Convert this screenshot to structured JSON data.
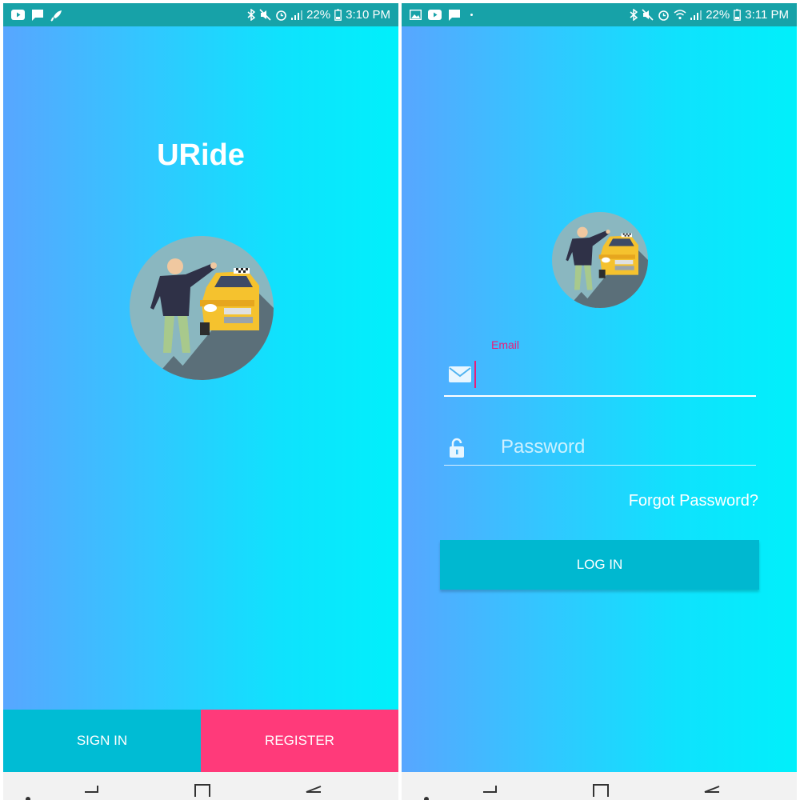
{
  "colors": {
    "statusbar": "#17a2a8",
    "gradient_start": "#58a6ff",
    "gradient_end": "#00f0fb",
    "signin_button": "#00bcd4",
    "register_button": "#ff3a7a",
    "login_button": "#00b8d0",
    "accent": "#e91e7a"
  },
  "left_screen": {
    "status": {
      "icons_left": [
        "youtube-icon",
        "message-icon",
        "rocket-icon"
      ],
      "icons_right": [
        "bluetooth-icon",
        "mute-icon",
        "alarm-icon",
        "signal-icon",
        "battery-icon"
      ],
      "battery": "22%",
      "time": "3:10 PM"
    },
    "title": "URide",
    "logo": "taxi-passenger-logo",
    "signin_label": "SIGN IN",
    "register_label": "REGISTER"
  },
  "right_screen": {
    "status": {
      "icons_left": [
        "image-icon",
        "youtube-icon",
        "message-icon",
        "dot-icon"
      ],
      "icons_right": [
        "bluetooth-icon",
        "mute-icon",
        "alarm-icon",
        "wifi-icon",
        "signal-icon",
        "battery-icon"
      ],
      "battery": "22%",
      "time": "3:11 PM"
    },
    "logo": "taxi-passenger-logo",
    "email_label": "Email",
    "email_value": "",
    "password_placeholder": "Password",
    "forgot_label": "Forgot Password?",
    "login_label": "LOG IN"
  },
  "navbar": {
    "items": [
      "recent-apps-dot-icon",
      "recents-icon",
      "home-icon",
      "back-icon"
    ]
  }
}
